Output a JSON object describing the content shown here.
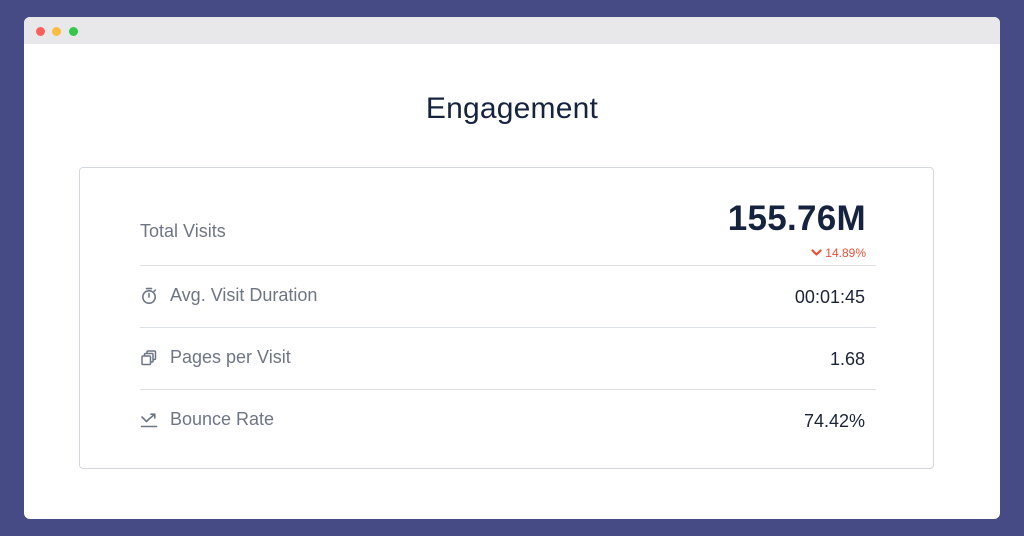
{
  "window": {
    "colors": {
      "background": "#474b85",
      "close": "#fc605c",
      "minimize": "#fdbc40",
      "maximize": "#34c84a"
    }
  },
  "page": {
    "title": "Engagement"
  },
  "metrics": {
    "total_visits": {
      "label": "Total Visits",
      "value": "155.76M",
      "change": "14.89%",
      "change_direction": "down",
      "change_color": "#e8503a"
    },
    "avg_visit_duration": {
      "label": "Avg. Visit Duration",
      "value": "00:01:45",
      "icon": "stopwatch-icon"
    },
    "pages_per_visit": {
      "label": "Pages per Visit",
      "value": "1.68",
      "icon": "pages-icon"
    },
    "bounce_rate": {
      "label": "Bounce Rate",
      "value": "74.42%",
      "icon": "bounce-icon"
    }
  }
}
